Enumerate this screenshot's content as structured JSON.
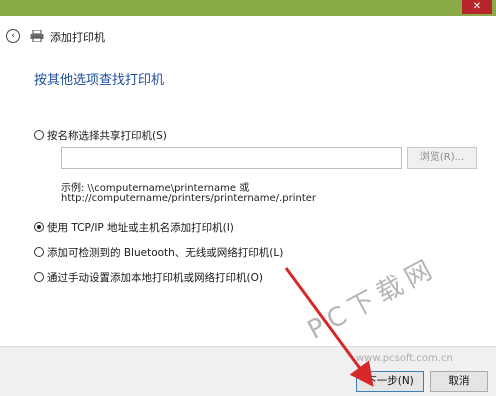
{
  "window": {
    "title": "添加打印机",
    "close_glyph": "✕"
  },
  "header": {
    "back_glyph": "‹"
  },
  "heading": "按其他选项查找打印机",
  "options": [
    {
      "label": "按名称选择共享打印机(S)",
      "checked": false
    },
    {
      "label": "使用 TCP/IP 地址或主机名添加打印机(I)",
      "checked": true
    },
    {
      "label": "添加可检测到的 Bluetooth、无线或网络打印机(L)",
      "checked": false
    },
    {
      "label": "通过手动设置添加本地打印机或网络打印机(O)",
      "checked": false
    }
  ],
  "share_name": {
    "value": "",
    "browse_label": "浏览(R)...",
    "example_line1": "示例: \\\\computername\\printername 或",
    "example_line2": "http://computername/printers/printername/.printer"
  },
  "footer": {
    "next_label": "下一步(N)",
    "cancel_label": "取消"
  },
  "watermark": {
    "text": "PC下载网",
    "url": "www.pcsoft.com.cn"
  },
  "colors": {
    "accent": "#1d4e9a",
    "titlebar": "#8aab47",
    "close": "#b8252a",
    "arrow": "#d6282a"
  }
}
